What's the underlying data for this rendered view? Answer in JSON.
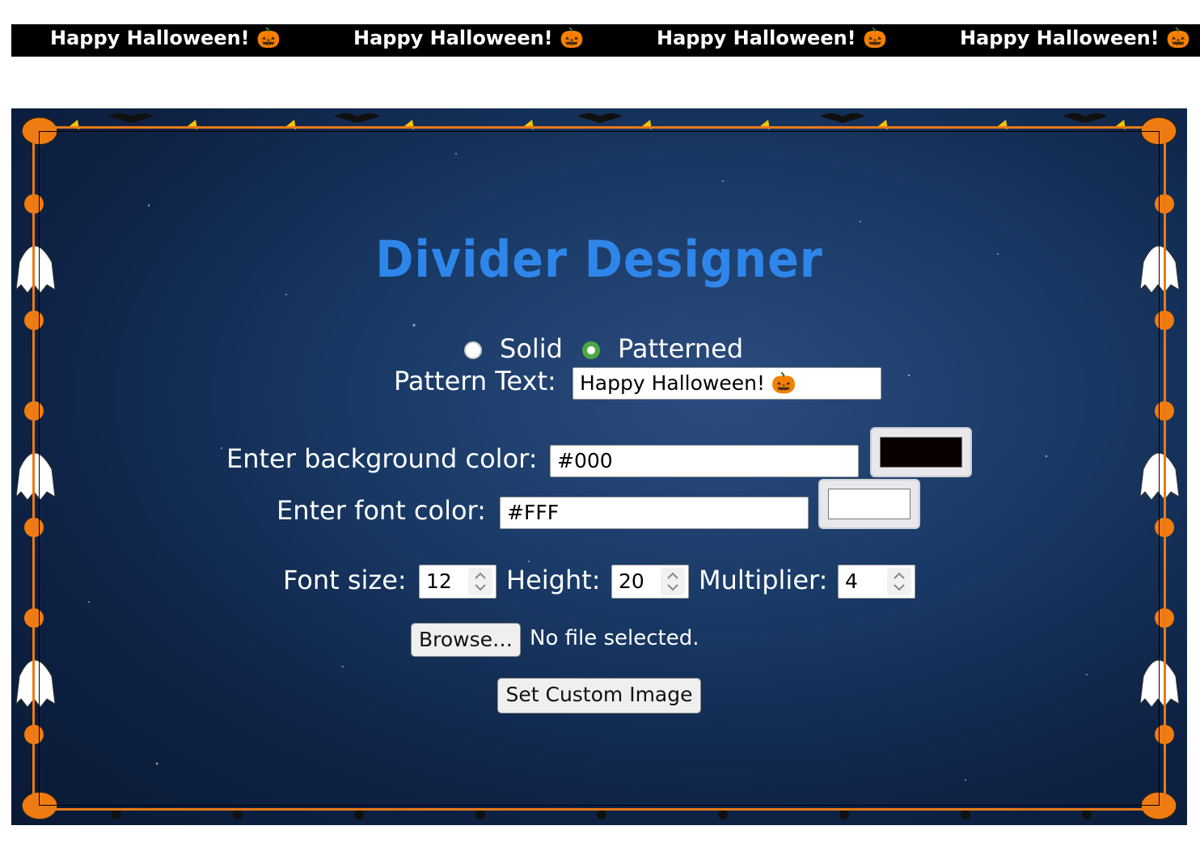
{
  "preview": {
    "items": [
      "Happy Halloween! 🎃",
      "Happy Halloween! 🎃",
      "Happy Halloween! 🎃",
      "Happy Halloween! 🎃"
    ],
    "background_color": "#000000",
    "font_color": "#FFFFFF"
  },
  "designer": {
    "title": "Divider Designer",
    "mode": {
      "solid_label": "Solid",
      "patterned_label": "Patterned",
      "selected": "Patterned"
    },
    "pattern_text": {
      "label": "Pattern Text:",
      "value": "Happy Halloween! 🎃"
    },
    "background_color": {
      "label": "Enter background color:",
      "value": "#000",
      "swatch": "#0a0000"
    },
    "font_color": {
      "label": "Enter font color:",
      "value": "#FFF",
      "swatch": "#ffffff"
    },
    "font_size": {
      "label": "Font size:",
      "value": "12"
    },
    "height": {
      "label": "Height:",
      "value": "20"
    },
    "multiplier": {
      "label": "Multiplier:",
      "value": "4"
    },
    "file": {
      "browse_label": "Browse…",
      "status": "No file selected."
    },
    "set_image_label": "Set Custom Image"
  },
  "theme": {
    "accent": "#2f86ea",
    "frame": "#e87a1a",
    "radio_checked": "#4ca845",
    "icons": [
      "pumpkin-icon",
      "ghost-icon",
      "candy-corn-icon",
      "bat-icon",
      "spider-icon"
    ]
  }
}
